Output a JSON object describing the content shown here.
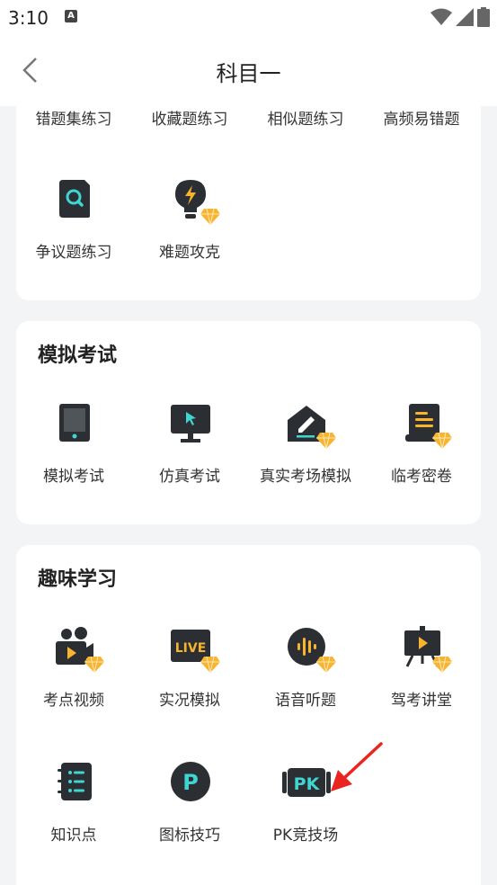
{
  "status_bar": {
    "time": "3:10"
  },
  "header": {
    "title": "科目一"
  },
  "section_practice": {
    "items": [
      {
        "label": "错题集练习"
      },
      {
        "label": "收藏题练习"
      },
      {
        "label": "相似题练习"
      },
      {
        "label": "高频易错题"
      },
      {
        "label": "争议题练习",
        "icon": "search-doc-icon"
      },
      {
        "label": "难题攻克",
        "icon": "lightbulb-icon",
        "premium": true
      }
    ]
  },
  "section_exam": {
    "title": "模拟考试",
    "items": [
      {
        "label": "模拟考试",
        "icon": "tablet-icon"
      },
      {
        "label": "仿真考试",
        "icon": "monitor-icon"
      },
      {
        "label": "真实考场模拟",
        "icon": "exam-room-icon",
        "premium": true
      },
      {
        "label": "临考密卷",
        "icon": "secret-paper-icon",
        "premium": true
      }
    ]
  },
  "section_fun": {
    "title": "趣味学习",
    "items": [
      {
        "label": "考点视频",
        "icon": "video-camera-icon",
        "premium": true
      },
      {
        "label": "实况模拟",
        "icon": "live-icon",
        "premium": true
      },
      {
        "label": "语音听题",
        "icon": "voice-icon",
        "premium": true
      },
      {
        "label": "驾考讲堂",
        "icon": "lecture-board-icon",
        "premium": true
      },
      {
        "label": "知识点",
        "icon": "notebook-icon"
      },
      {
        "label": "图标技巧",
        "icon": "p-circle-icon"
      },
      {
        "label": "PK竞技场",
        "icon": "pk-icon"
      }
    ]
  },
  "colors": {
    "icon_dark": "#2b2f33",
    "accent": "#3fd6d2",
    "gem": "#f7b42c",
    "arrow": "#e8261f"
  }
}
